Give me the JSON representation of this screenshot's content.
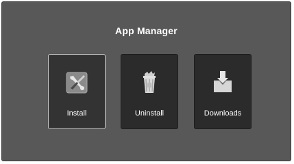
{
  "app": {
    "title": "App Manager"
  },
  "tiles": [
    {
      "label": "Install",
      "icon": "wrench-screwdriver-icon",
      "selected": true
    },
    {
      "label": "Uninstall",
      "icon": "trash-can-icon",
      "selected": false
    },
    {
      "label": "Downloads",
      "icon": "download-tray-icon",
      "selected": false
    }
  ],
  "colors": {
    "background": "#585858",
    "tile": "#2b2b2b",
    "selected_border": "#c9c9c9",
    "text": "#ffffff"
  }
}
